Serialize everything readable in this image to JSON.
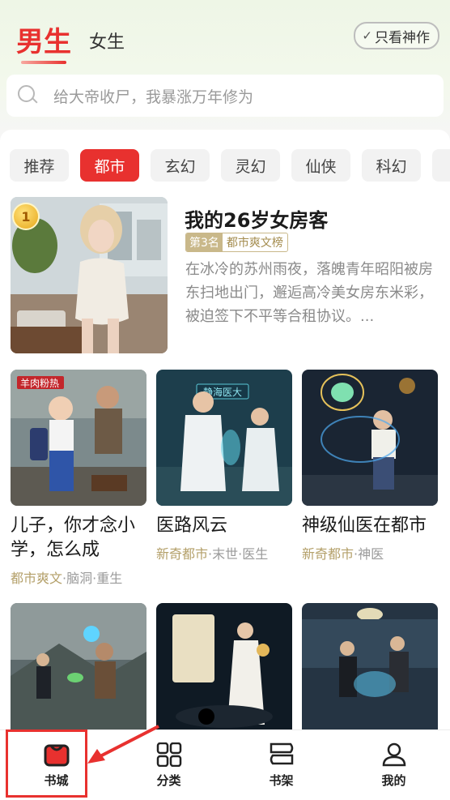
{
  "header": {
    "gender_tabs": [
      "男生",
      "女生"
    ],
    "filter_button": "只看神作",
    "search_placeholder": "给大帝收尸，我暴涨万年修为"
  },
  "categories": [
    "推荐",
    "都市",
    "玄幻",
    "灵幻",
    "仙侠",
    "科幻",
    ""
  ],
  "active_category": "都市",
  "featured": {
    "rank_number": "1",
    "title": "我的26岁女房客",
    "rank_label": "第3名",
    "list_name": "都市爽文榜",
    "description": "在冰冷的苏州雨夜，落魄青年昭阳被房东扫地出门，邂逅高冷美女房东米彩，被迫签下不平等合租协议。..."
  },
  "books": [
    {
      "title": "儿子，你才念小学，怎么成",
      "tag_main": "都市爽文",
      "tag_rest": "脑洞·重生",
      "cover_text": "羊肉粉热"
    },
    {
      "title": "医路风云",
      "tag_main": "新奇都市",
      "tag_rest": "末世·医生",
      "cover_text": "静海医大"
    },
    {
      "title": "神级仙医在都市",
      "tag_main": "新奇都市",
      "tag_rest": "神医",
      "cover_text": ""
    }
  ],
  "bottom_nav": [
    {
      "label": "书城",
      "icon": "bag-icon"
    },
    {
      "label": "分类",
      "icon": "grid-icon"
    },
    {
      "label": "书架",
      "icon": "bookshelf-icon"
    },
    {
      "label": "我的",
      "icon": "user-icon"
    }
  ],
  "colors": {
    "accent": "#e8312f",
    "tag_gold": "#b4a06a"
  }
}
